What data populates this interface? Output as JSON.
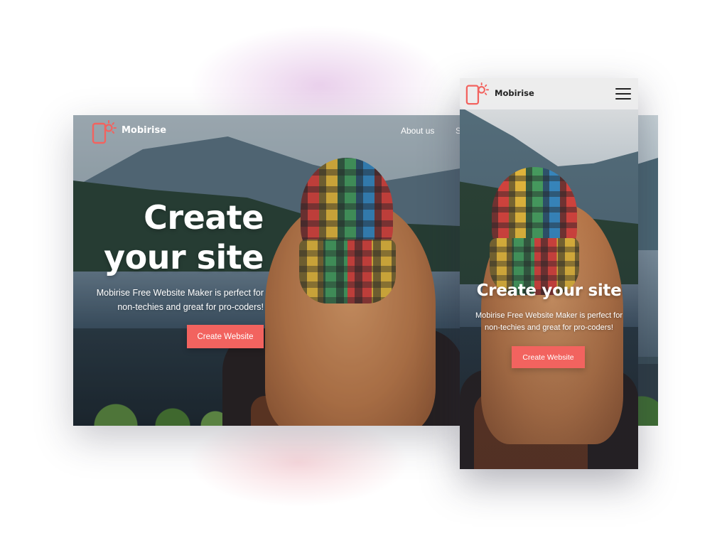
{
  "brand": {
    "name": "Mobirise",
    "accent_color": "#f2635f",
    "logo_icon": "phone-sun-logo-icon"
  },
  "desktop": {
    "nav_links": [
      "About us",
      "S"
    ],
    "hero_title_line1": "Create",
    "hero_title_line2": "your site",
    "hero_subtitle_line1": "Mobirise Free Website Maker is perfect for",
    "hero_subtitle_line2": "non-techies and great for pro-coders!",
    "cta_label": "Create Website"
  },
  "mobile": {
    "menu_icon": "hamburger-menu-icon",
    "hero_title": "Create your site",
    "hero_subtitle_line1": "Mobirise Free Website Maker is perfect for",
    "hero_subtitle_line2": "non-techies and great for pro-coders!",
    "cta_label": "Create Website"
  }
}
